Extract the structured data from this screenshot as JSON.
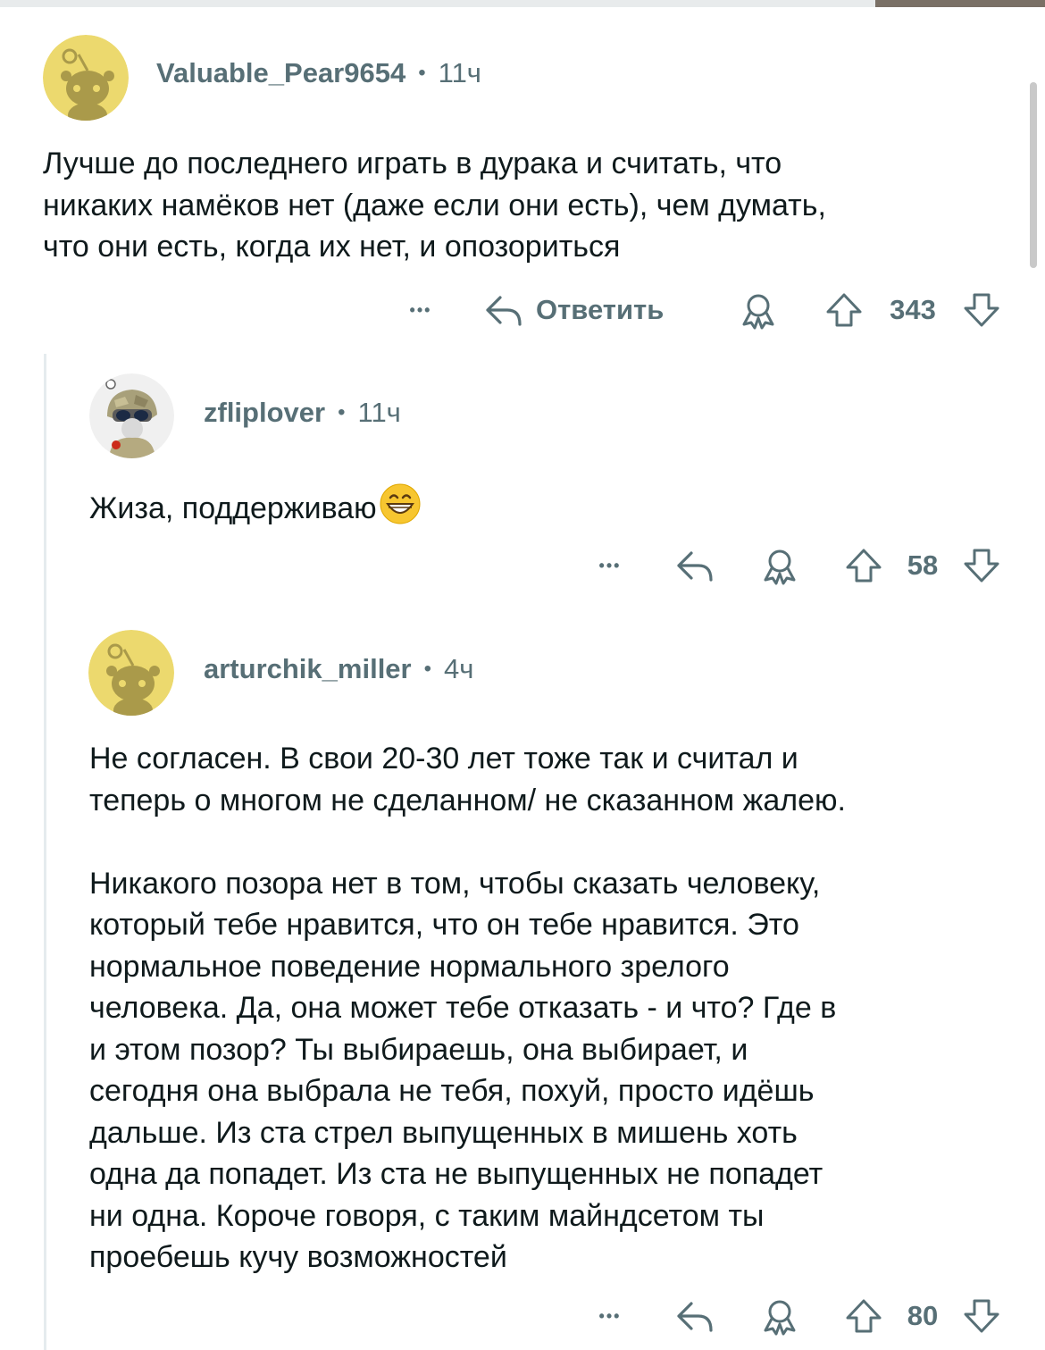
{
  "comments": [
    {
      "username": "Valuable_Pear9654",
      "separator": "•",
      "time": "11ч",
      "avatar_icon": "snoo-default-avatar",
      "text_lines": [
        "Лучше до последнего играть в дурака и считать, что",
        "никаких намёков нет (даже если они есть), чем думать,",
        "что они есть, когда их нет, и опозориться"
      ],
      "actions": {
        "more": "•••",
        "reply_label": "Ответить",
        "score": "343"
      }
    },
    {
      "username": "zfliplover",
      "separator": "•",
      "time": "11ч",
      "avatar_icon": "custom-helmet-avatar",
      "text_lines": [
        "Жиза, поддерживаю"
      ],
      "emoji": "grinning-face-emoji",
      "actions": {
        "more": "•••",
        "score": "58"
      }
    },
    {
      "username": "arturchik_miller",
      "separator": "•",
      "time": "4ч",
      "avatar_icon": "snoo-default-avatar",
      "paragraph1": [
        "Не согласен. В свои 20-30 лет тоже так и считал и",
        "теперь о многом не сделанном/ не сказанном жалею."
      ],
      "paragraph2": [
        "Никакого позора нет в том, чтобы сказать человеку,",
        "который тебе нравится, что он тебе нравится. Это",
        "нормальное поведение нормального зрелого",
        "человека. Да, она может тебе отказать - и что? Где в",
        "и этом позор? Ты выбираешь, она выбирает, и",
        "сегодня она выбрала не тебя, похуй, просто идёшь",
        "дальше. Из ста стрел выпущенных в мишень хоть",
        "одна да попадет. Из ста не выпущенных не попадет",
        "ни одна. Короче говоря, с таким майндсетом ты",
        "проебешь кучу возможностей"
      ],
      "actions": {
        "more": "•••",
        "score": "80"
      }
    }
  ],
  "colors": {
    "meta": "#576f76",
    "text": "#0f1a1c",
    "avatar_yellow": "#ecd96e",
    "avatar_snoo": "#aa9a4a"
  }
}
